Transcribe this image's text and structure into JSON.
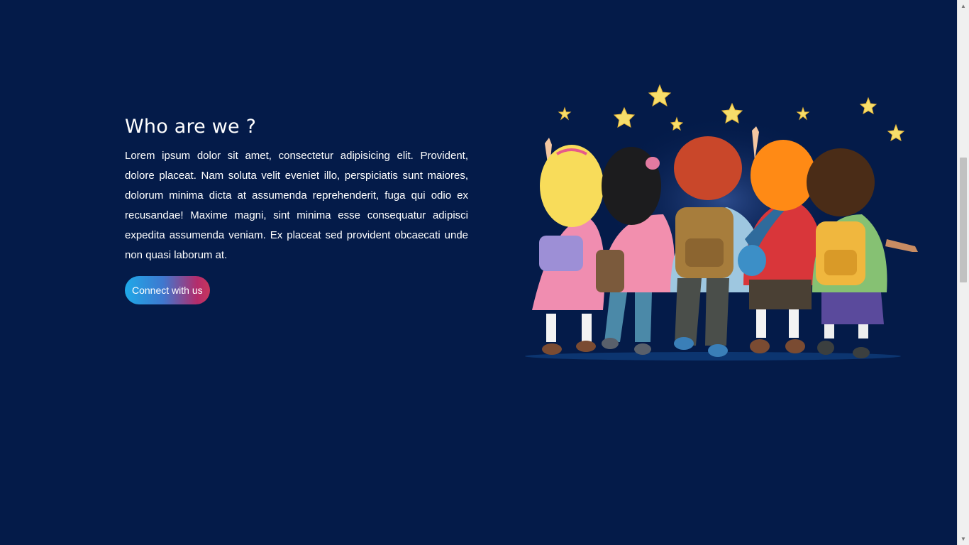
{
  "about": {
    "heading": "Who are we ?",
    "body": "Lorem ipsum dolor sit amet, consectetur adipisicing elit. Provident, dolore placeat. Nam soluta velit eveniet illo, perspiciatis sunt maiores, dolorum minima dicta at assumenda reprehenderit, fuga qui odio ex recusandae! Maxime magni, sint minima esse consequatur adipisci expedita assumenda veniam. Ex placeat sed provident obcaecati unde non quasi laborum at.",
    "cta_label": "Connect with us"
  },
  "colors": {
    "background": "#041b49",
    "cta_gradient_start": "#1ea9e8",
    "cta_gradient_end": "#c8365d"
  },
  "scrollbar": {
    "up_icon": "triangle-up-icon",
    "down_icon": "triangle-down-icon"
  }
}
